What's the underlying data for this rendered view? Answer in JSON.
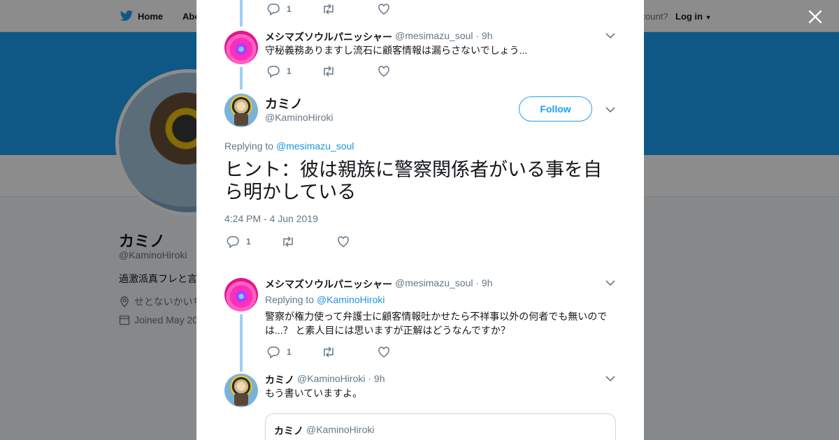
{
  "nav": {
    "home": "Home",
    "about": "Abo",
    "account_prompt": "ccount?",
    "login": "Log in"
  },
  "profile": {
    "name": "カミノ",
    "handle": "@KaminoHiroki",
    "bio": "過激派真フレと言",
    "location": "せとないかいち",
    "joined": "Joined May 20"
  },
  "tweets": {
    "t0": {
      "reply_count": "1"
    },
    "t1": {
      "name": "メシマズソウルパニッシャー",
      "handle": "@mesimazu_soul",
      "time": "· 9h",
      "text": "守秘義務ありますし流石に顧客情報は漏らさないでしょう...",
      "reply_count": "1"
    },
    "main": {
      "name": "カミノ",
      "handle": "@KaminoHiroki",
      "follow_label": "Follow",
      "replying_prefix": "Replying to",
      "replying_to": "@mesimazu_soul",
      "text": "ヒント：彼は親族に警察関係者がいる事を自ら明かしている",
      "timestamp": "4:24 PM - 4 Jun 2019",
      "reply_count": "1"
    },
    "t3": {
      "name": "メシマズソウルパニッシャー",
      "handle": "@mesimazu_soul",
      "time": "· 9h",
      "replying_prefix": "Replying to",
      "replying_to": "@KaminoHiroki",
      "text": "警察が権力使って弁護士に顧客情報吐かせたら不祥事以外の何者でも無いのでは...？ と素人目には思いますが正解はどうなんですか？",
      "reply_count": "1"
    },
    "t4": {
      "name": "カミノ",
      "handle": "@KaminoHiroki",
      "time": "· 9h",
      "text": "もう書いていますよ。"
    },
    "quote": {
      "name": "カミノ",
      "handle": "@KaminoHiroki"
    }
  },
  "icons": [
    "twitter-bird-icon",
    "home-icon",
    "close-icon",
    "reply-icon",
    "retweet-icon",
    "like-icon",
    "chevron-down-icon",
    "location-icon",
    "calendar-icon"
  ],
  "colors": {
    "brand": "#1da1f2",
    "link": "#1b95e0",
    "muted": "#657786",
    "thread": "#9ed0f2"
  }
}
